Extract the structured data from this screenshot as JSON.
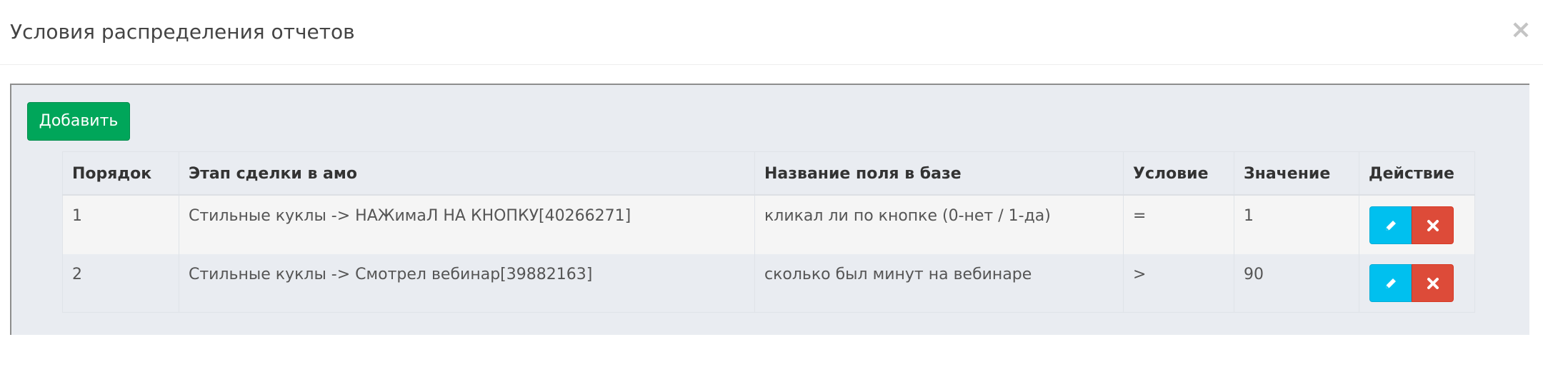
{
  "modal": {
    "title": "Условия распределения отчетов",
    "close_label": "×"
  },
  "toolbar": {
    "add_label": "Добавить"
  },
  "colors": {
    "add_button": "#00a65a",
    "edit_button": "#00c0ef",
    "delete_button": "#dd4b39",
    "panel_bg": "#e9ecf1"
  },
  "table": {
    "headers": [
      "Порядок",
      "Этап сделки в амо",
      "Название поля в базе",
      "Условие",
      "Значение",
      "Действие"
    ],
    "rows": [
      {
        "order": "1",
        "stage": "Стильные куклы -> НАЖимаЛ НА КНОПКУ[40266271]",
        "field": "кликал ли по кнопке (0-нет / 1-да)",
        "condition": "=",
        "value": "1",
        "actions": [
          "pencil-icon",
          "times-icon"
        ]
      },
      {
        "order": "2",
        "stage": "Стильные куклы -> Смотрел вебинар[39882163]",
        "field": "сколько был минут на вебинаре",
        "condition": ">",
        "value": "90",
        "actions": [
          "pencil-icon",
          "times-icon"
        ]
      }
    ]
  }
}
